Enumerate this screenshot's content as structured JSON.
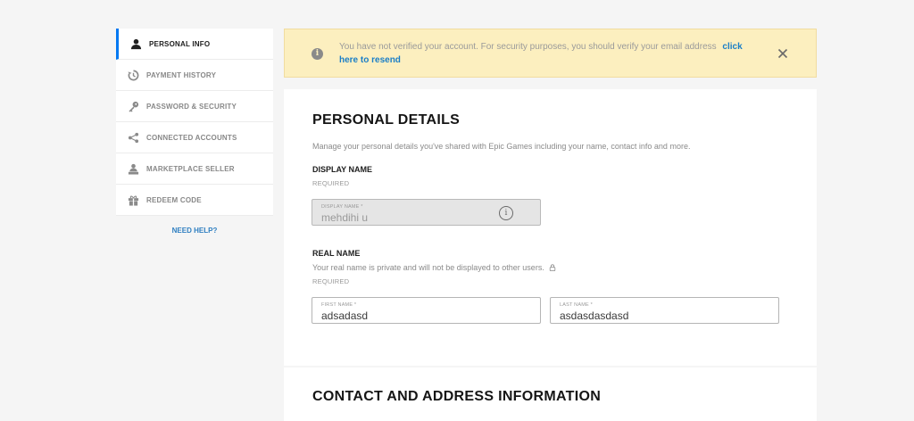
{
  "sidebar": {
    "items": [
      {
        "label": "PERSONAL INFO",
        "icon": "user-icon"
      },
      {
        "label": "PAYMENT HISTORY",
        "icon": "history-icon"
      },
      {
        "label": "PASSWORD & SECURITY",
        "icon": "key-icon"
      },
      {
        "label": "CONNECTED ACCOUNTS",
        "icon": "share-icon"
      },
      {
        "label": "MARKETPLACE SELLER",
        "icon": "seller-icon"
      },
      {
        "label": "REDEEM CODE",
        "icon": "gift-icon"
      }
    ],
    "need_help": "NEED HELP?"
  },
  "alert": {
    "message": "You have not verified your account. For security purposes, you should verify your email address",
    "link": "click here to resend",
    "info_symbol": "i",
    "close_symbol": "×"
  },
  "personal_details": {
    "title": "PERSONAL DETAILS",
    "description": "Manage your personal details you've shared with Epic Games including your name, contact info and more.",
    "display_name": {
      "label": "DISPLAY NAME",
      "required": "REQUIRED",
      "field_label": "DISPLAY NAME *",
      "value": "mehdihi u",
      "info_symbol": "i"
    },
    "real_name": {
      "label": "REAL NAME",
      "note": "Your real name is private and will not be displayed to other users.",
      "required": "REQUIRED",
      "first_name_label": "FIRST NAME *",
      "first_name_value": "adsadasd",
      "last_name_label": "LAST NAME *",
      "last_name_value": "asdasdasdasd"
    }
  },
  "contact": {
    "title": "CONTACT AND ADDRESS INFORMATION"
  },
  "colors": {
    "accent": "#0078f2",
    "link": "#1a7ec7",
    "alert_bg": "#fcefbf"
  }
}
